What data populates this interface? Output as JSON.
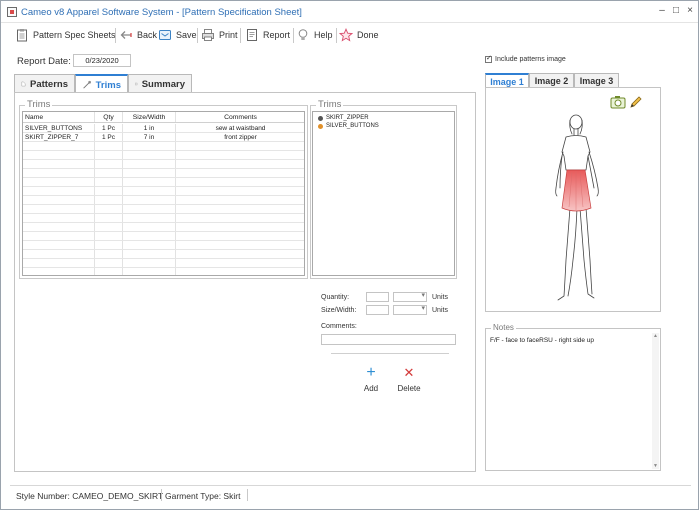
{
  "window": {
    "title": "Cameo v8 Apparel Software System - [Pattern Specification Sheet]",
    "minimize": "–",
    "maximize": "□",
    "close": "×"
  },
  "toolbar": {
    "items": [
      {
        "label": "Pattern Spec Sheets",
        "icon": "clipboard-icon"
      },
      {
        "label": "Back",
        "icon": "back-arrow-icon"
      },
      {
        "label": "Save",
        "icon": "save-icon"
      },
      {
        "label": "Print",
        "icon": "printer-icon"
      },
      {
        "label": "Report",
        "icon": "report-icon"
      },
      {
        "label": "Help",
        "icon": "lightbulb-icon"
      },
      {
        "label": "Done",
        "icon": "star-icon"
      }
    ]
  },
  "report": {
    "label": "Report Date:",
    "date": "0/23/2020"
  },
  "tabs": [
    {
      "label": "Patterns",
      "icon": "patterns-icon",
      "active": false
    },
    {
      "label": "Trims",
      "icon": "needle-icon",
      "active": true
    },
    {
      "label": "Summary",
      "icon": "summary-icon",
      "active": false
    }
  ],
  "trims_grid": {
    "title": "Trims",
    "columns": [
      "Name",
      "Qty",
      "Size/Width",
      "Comments"
    ],
    "rows": [
      {
        "name": "SILVER_BUTTONS",
        "qty": "1 Pc",
        "size": "1 in",
        "comments": "sew at waistband"
      },
      {
        "name": "SKIRT_ZIPPER_7",
        "qty": "1 Pc",
        "size": "7 in",
        "comments": "front zipper"
      }
    ]
  },
  "trims_tree": {
    "title": "Trims",
    "items": [
      {
        "label": "SKIRT_ZIPPER",
        "color": "#555555"
      },
      {
        "label": "SILVER_BUTTONS",
        "color": "#e0902a"
      }
    ]
  },
  "form": {
    "quantity_label": "Quantity:",
    "size_label": "Size/Width:",
    "units_label": "Units",
    "comments_label": "Comments:"
  },
  "actions": {
    "add": {
      "label": "Add",
      "glyph": "+",
      "color": "#2f8fd3"
    },
    "delete": {
      "label": "Delete",
      "glyph": "✕",
      "color": "#d33a3a"
    }
  },
  "image_options": {
    "include_label": "Include patterns image",
    "checked": true
  },
  "image_tabs": [
    {
      "label": "Image 1",
      "active": true
    },
    {
      "label": "Image 2",
      "active": false
    },
    {
      "label": "Image 3",
      "active": false
    }
  ],
  "notes": {
    "title": "Notes",
    "text": "F/F - face to faceRSU - right side up"
  },
  "status": {
    "style_number": "Style Number: CAMEO_DEMO_SKIRT",
    "garment_type": "Garment Type: Skirt"
  },
  "colors": {
    "accent": "#2f7fd3",
    "skirt": "#e85a5a"
  }
}
